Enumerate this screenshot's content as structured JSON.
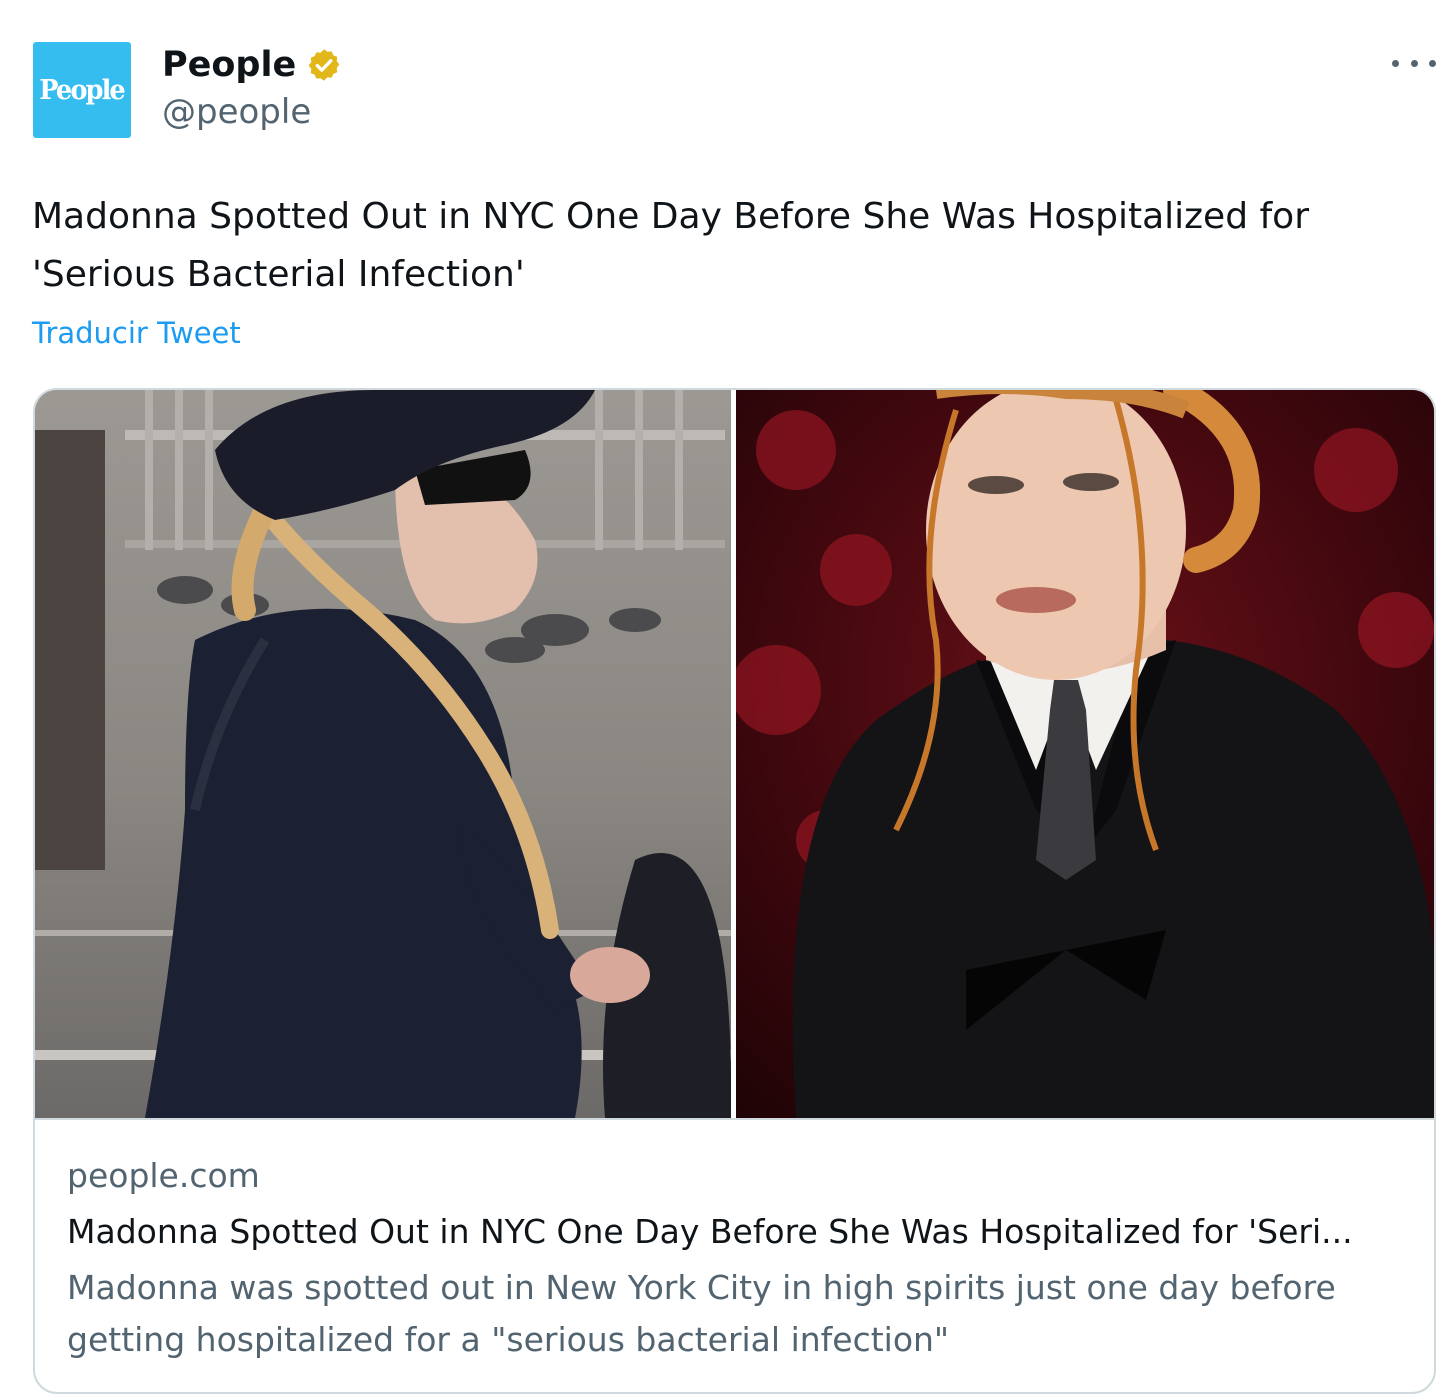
{
  "author": {
    "avatar_text": "People",
    "display_name": "People",
    "handle": "@people",
    "verified_icon": "verified-gold-badge-icon"
  },
  "tweet": {
    "text": "Madonna Spotted Out in NYC One Day Before She Was Hospitalized for 'Serious Bacterial Infection'",
    "translate_label": "Traducir Tweet",
    "more_icon": "more-options-icon"
  },
  "card": {
    "domain": "people.com",
    "title": "Madonna Spotted Out in NYC One Day Before She Was Hospitalized for 'Seri...",
    "description": "Madonna was spotted out in New York City in high spirits just one day before getting hospitalized for a \"serious bacterial infection\""
  },
  "colors": {
    "link_blue": "#1d9bf0",
    "secondary_text": "#536471",
    "avatar_bg": "#35bdf0",
    "verified_gold": "#e2b719",
    "card_border": "#cfd9de"
  }
}
